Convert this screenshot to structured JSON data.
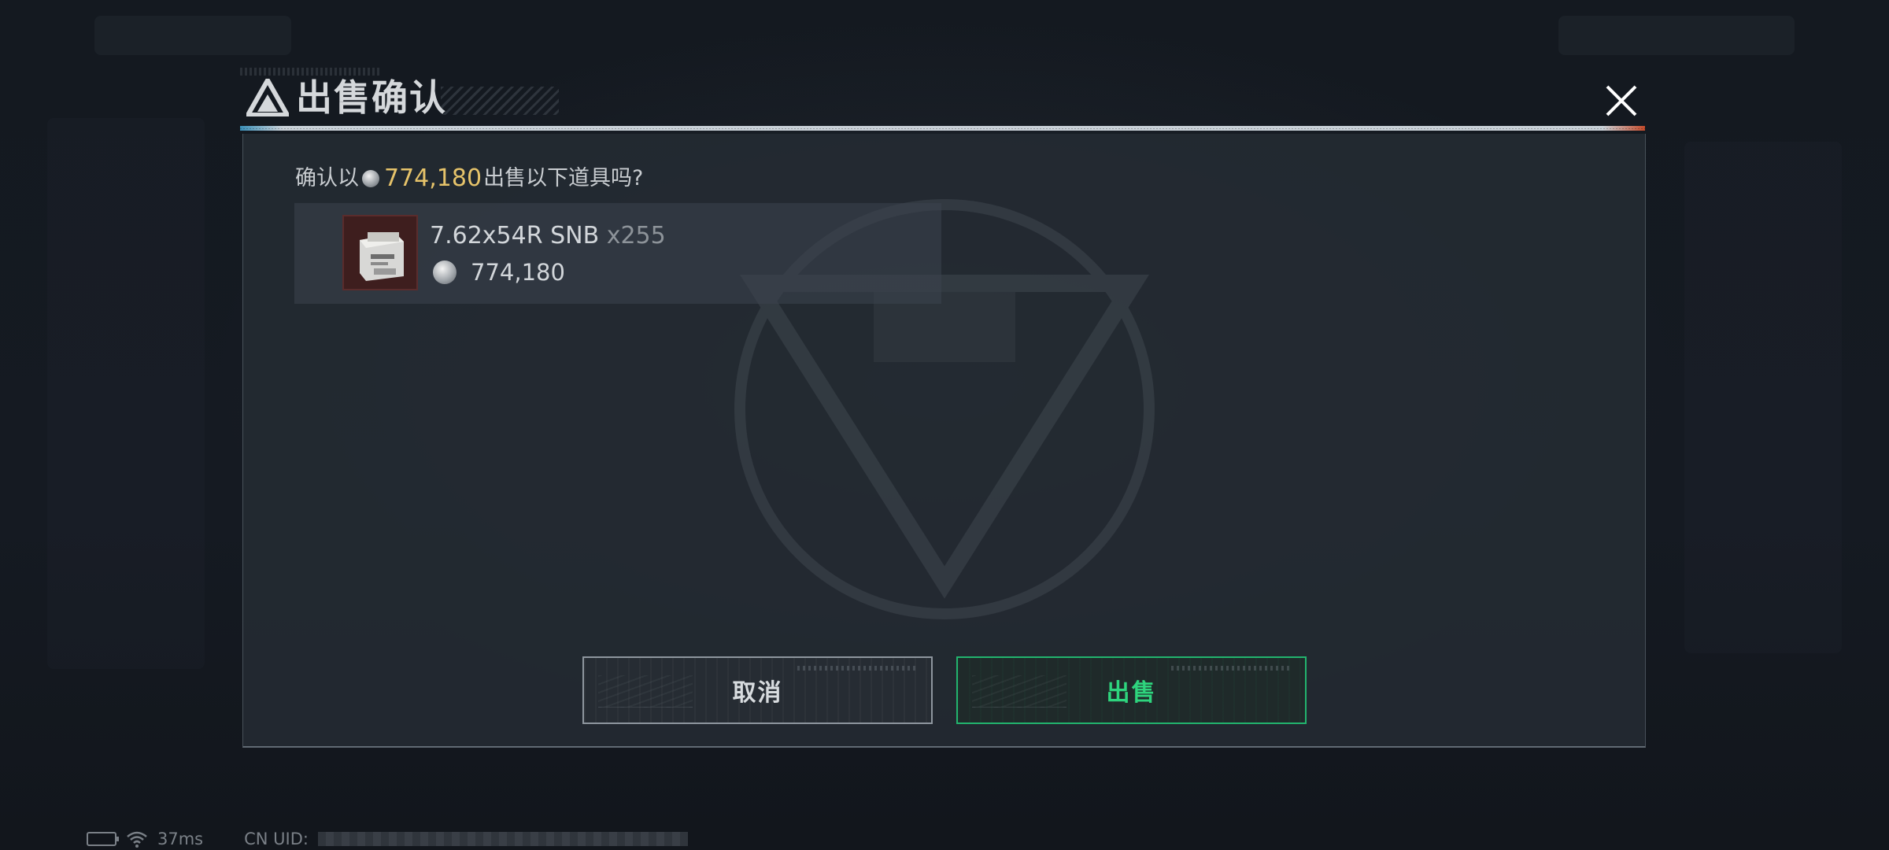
{
  "dialog": {
    "title": "出售确认"
  },
  "confirm": {
    "prefix": "确认以",
    "amount": "774,180",
    "suffix": "出售以下道具吗?"
  },
  "item": {
    "name": "7.62x54R SNB",
    "quantity": "x255",
    "price": "774,180"
  },
  "buttons": {
    "cancel_label": "取消",
    "sell_label": "出售"
  },
  "status": {
    "ping": "37ms",
    "uid_label": "CN UID:"
  },
  "colors": {
    "accent_green": "#2ed47d",
    "price_gold": "#e6c36a"
  },
  "icons": {
    "close": "close-icon",
    "coin": "coin-icon",
    "logo": "triangle-logo-icon"
  }
}
